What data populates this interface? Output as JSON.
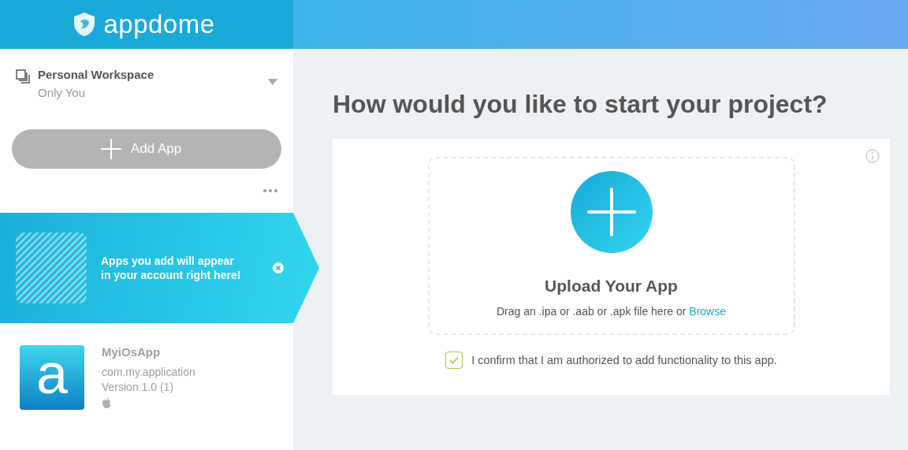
{
  "header": {
    "logo": "appdome"
  },
  "workspace": {
    "name": "Personal Workspace",
    "subtitle": "Only You",
    "expanded": false
  },
  "add_app_button": {
    "label": "Add App",
    "disabled": true
  },
  "banner": {
    "text": "Apps you add will appear in your account right here!"
  },
  "apps": [
    {
      "name": "MyiOsApp",
      "bundle_id": "com.my.application",
      "version": "Version 1.0 (1)",
      "icon_letter": "a"
    }
  ],
  "main": {
    "title": "How would you like to start your project?",
    "upload": {
      "title": "Upload Your App",
      "hint": "Drag an .ipa or .aab or .apk file here or",
      "link": "Browse"
    },
    "confirm": {
      "label": "I confirm that I am authorized to add functionality to this app.",
      "checked": true
    }
  }
}
